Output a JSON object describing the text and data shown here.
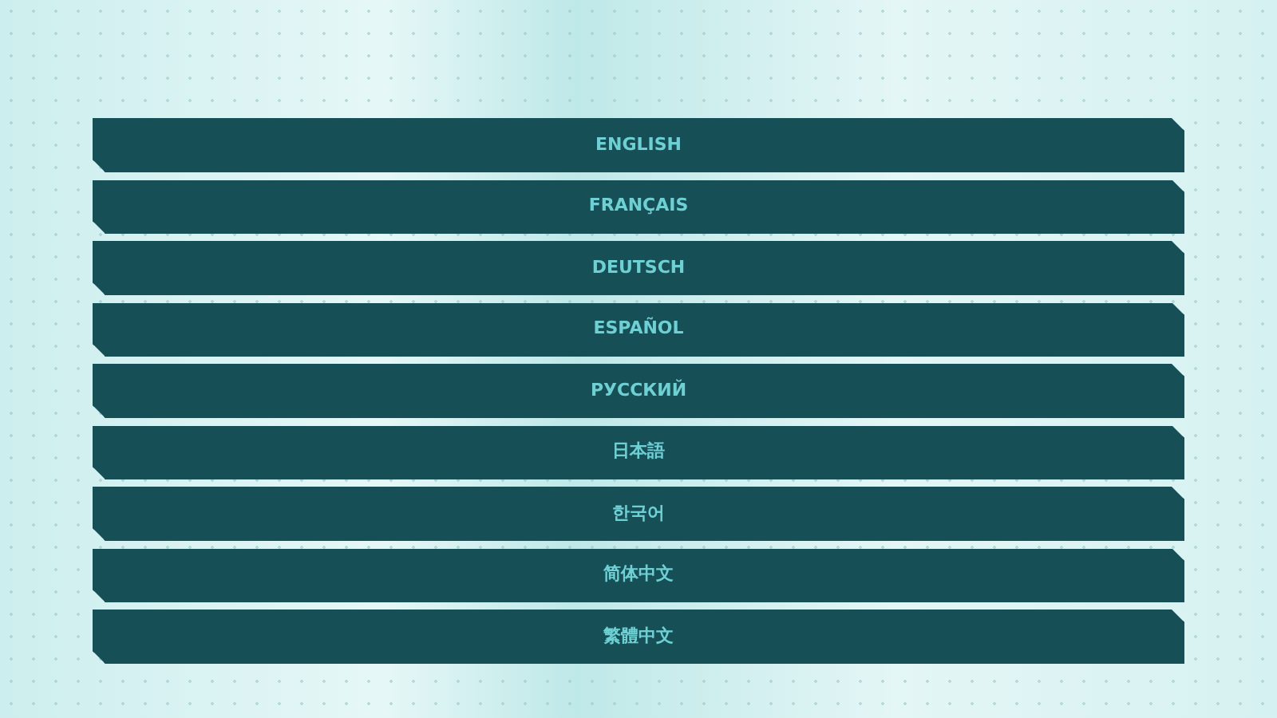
{
  "languages": [
    {
      "label": "ENGLISH"
    },
    {
      "label": "FRANÇAIS"
    },
    {
      "label": "DEUTSCH"
    },
    {
      "label": "ESPAÑOL"
    },
    {
      "label": "РУССКИЙ"
    },
    {
      "label": "日本語"
    },
    {
      "label": "한국어"
    },
    {
      "label": "简体中文"
    },
    {
      "label": "繁體中文"
    }
  ]
}
